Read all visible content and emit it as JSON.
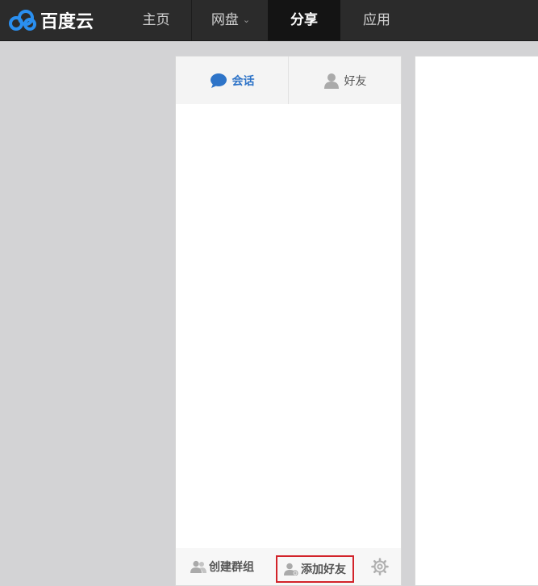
{
  "header": {
    "logo_text": "百度云",
    "nav": {
      "home": "主页",
      "netdisk": "网盘",
      "share": "分享",
      "apps": "应用"
    }
  },
  "panel": {
    "tabs": {
      "chat": "会话",
      "friends": "好友"
    },
    "footer": {
      "create_group": "创建群组",
      "add_friend": "添加好友"
    }
  },
  "icons": {
    "logo": "baidu-cloud-icon",
    "netdisk_caret": "chevron-down-icon",
    "chat": "chat-bubble-icon",
    "friends": "user-icon",
    "create_group": "group-icon",
    "add_friend": "add-user-icon",
    "settings": "gear-icon"
  },
  "colors": {
    "topbar": "#2b2b2b",
    "active_nav": "#141414",
    "accent_blue": "#2e74c8",
    "highlight_red": "#d2232a"
  }
}
